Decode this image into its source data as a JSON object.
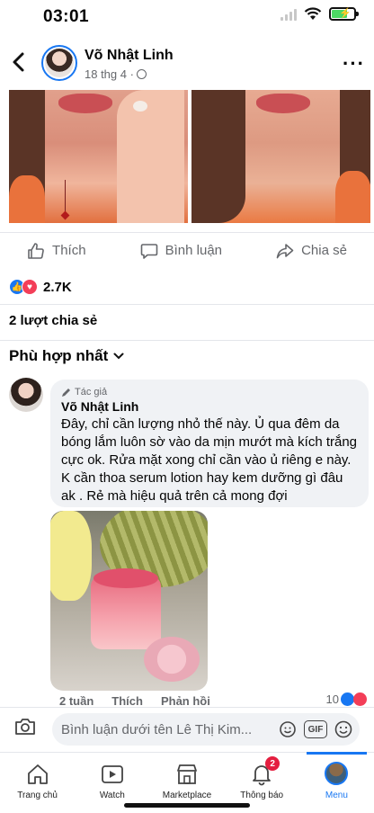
{
  "status_bar": {
    "time": "03:01"
  },
  "post": {
    "author": "Võ Nhật Linh",
    "date": "18 thg 4 ·",
    "actions": {
      "like": "Thích",
      "comment": "Bình luận",
      "share": "Chia sẻ"
    },
    "reaction_count": "2.7K",
    "shares": "2 lượt chia sẻ"
  },
  "comments_section": {
    "sort_label": "Phù hợp nhất",
    "comment": {
      "badge": "Tác giả",
      "author": "Võ Nhật Linh",
      "text": "Đây, chỉ cần lượng nhỏ thế này. Ủ qua đêm da bóng lắm luôn sờ vào da mịn mướt mà kích trắng cực ok. Rửa mặt xong chỉ cần vào ủ riêng e này. K cần thoa serum lotion hay kem dưỡng gì đâu ak . Rẻ mà hiệu quả trên cả mong đợi",
      "time": "2 tuần",
      "like": "Thích",
      "reply": "Phản hồi",
      "reaction_count": "10"
    }
  },
  "composer": {
    "placeholder": "Bình luận dưới tên Lê Thị Kim...",
    "gif": "GIF"
  },
  "tabs": [
    {
      "label": "Trang chủ",
      "icon": "home-icon"
    },
    {
      "label": "Watch",
      "icon": "video-icon"
    },
    {
      "label": "Marketplace",
      "icon": "shop-icon"
    },
    {
      "label": "Thông báo",
      "icon": "bell-icon",
      "badge": "2"
    },
    {
      "label": "Menu",
      "icon": "menu-avatar-icon",
      "active": true
    }
  ],
  "colors": {
    "accent": "#1877f2",
    "love": "#f33e58",
    "badge": "#e41e3f"
  }
}
